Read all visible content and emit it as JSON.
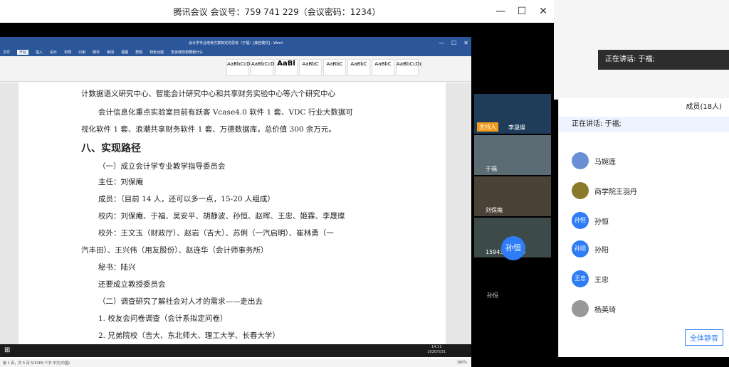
{
  "meeting": {
    "title": "腾讯会议  会议号：759 741 229（会议密码：1234）",
    "speaking_banner": "正在讲话: 于福;"
  },
  "word": {
    "window_title": "会计学专业培养方案制定的思考（于福）[兼容模式] - Word",
    "tabs": [
      "文件",
      "开始",
      "插入",
      "设计",
      "布局",
      "引用",
      "邮件",
      "审阅",
      "视图",
      "帮助",
      "特色功能",
      "告诉我你想要做什么"
    ],
    "styles": [
      "AaBbCcDc",
      "AaBbCcDc",
      "AaBl",
      "AaBbC",
      "AaBbC",
      "AaBbC",
      "AaBbC",
      "AaBbCcDc",
      "AaBbCcDc"
    ],
    "status": "第 1 页，共 5 页    5/3269 个字    中文(中国)",
    "zoom": "180%",
    "lines": [
      "计数据语义研究中心、智能会计研究中心和共享财务实验中心等六个研究中心",
      "会计信息化重点实验室目前有跃客 Vcase4.0 软件 1 套、VDC 行业大数据可",
      "视化软件 1 套、浪潮共享财务软件 1 套、万德数据库，总价值 300 余万元。",
      "八、实现路径",
      "（一）成立会计学专业教学指导委员会",
      "主任：刘保庵",
      "成员：（目前 14 人，还可以多一点，15-20 人组成）",
      "校内：刘保庵、于福、吴安平、胡静波、孙恒、赵晖、王忠、姬霖、李晟璨",
      "校外：王文玉（财政厅）、赵岩（吉大）、苏俐（一汽启明）、崔林勇（一",
      "汽丰田）、王兴伟（用友股份）、赵连华（会计师事务所）",
      "秘书：陆兴",
      "还要成立教授委员会",
      "（二）调查研究了解社会对人才的需求——走出去",
      "1. 校友会问卷调查（会计系拟定问卷）",
      "2. 兄弟院校（吉大、东北师大、理工大学、长春大学）"
    ]
  },
  "videos": [
    {
      "name": "李晟璨",
      "host_label": "主持人"
    },
    {
      "name": "于福"
    },
    {
      "name": "刘保庵"
    },
    {
      "name": "15943099990"
    },
    {
      "name": "孙恒",
      "avatar": "孙恒"
    }
  ],
  "members_panel": {
    "title": "成员(18人)",
    "speaking": "正在讲话: 于福;",
    "members": [
      {
        "name": "马婉莲"
      },
      {
        "name": "商学院王羽丹"
      },
      {
        "name": "孙恒",
        "avatar": "孙恒"
      },
      {
        "name": "孙阳",
        "avatar": "孙阳"
      },
      {
        "name": "王忠",
        "avatar": "王忠"
      },
      {
        "name": "杨英琦"
      }
    ],
    "mute_all": "全体静音"
  },
  "taskbar": {
    "time": "14:11",
    "date": "2020/3/31"
  }
}
